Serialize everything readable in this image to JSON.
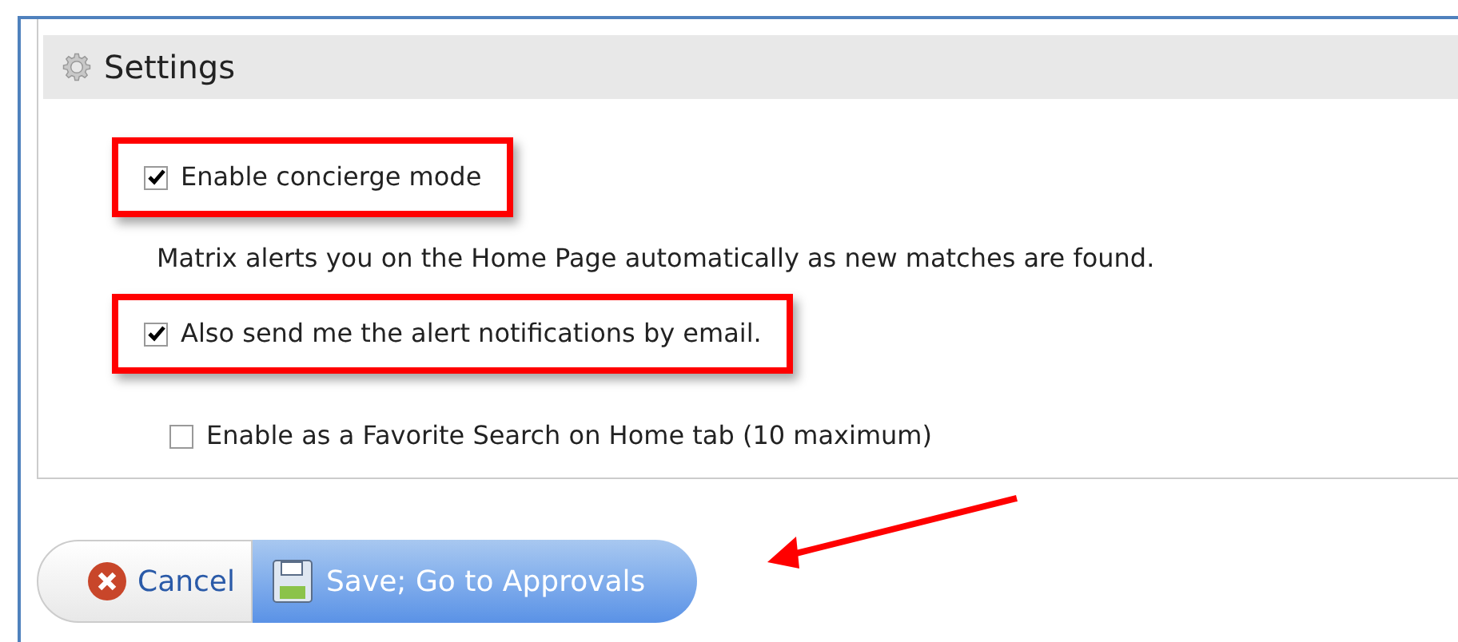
{
  "section": {
    "title": "Settings"
  },
  "items": [
    {
      "kind": "checkbox",
      "label": "Enable concierge mode",
      "checked": true,
      "highlighted": true
    },
    {
      "kind": "note",
      "label": "Matrix alerts you on the Home Page automatically as new matches are found."
    },
    {
      "kind": "checkbox",
      "label": "Also send me the alert notifications by email.",
      "checked": true,
      "highlighted": true
    },
    {
      "kind": "checkbox",
      "label": "Enable as a Favorite Search on Home tab (10 maximum)",
      "checked": false,
      "highlighted": false
    }
  ],
  "buttons": [
    {
      "kind": "cancel",
      "label": "Cancel"
    },
    {
      "kind": "save",
      "label": "Save; Go to Approvals"
    }
  ],
  "annotation": {
    "kind": "arrow"
  }
}
